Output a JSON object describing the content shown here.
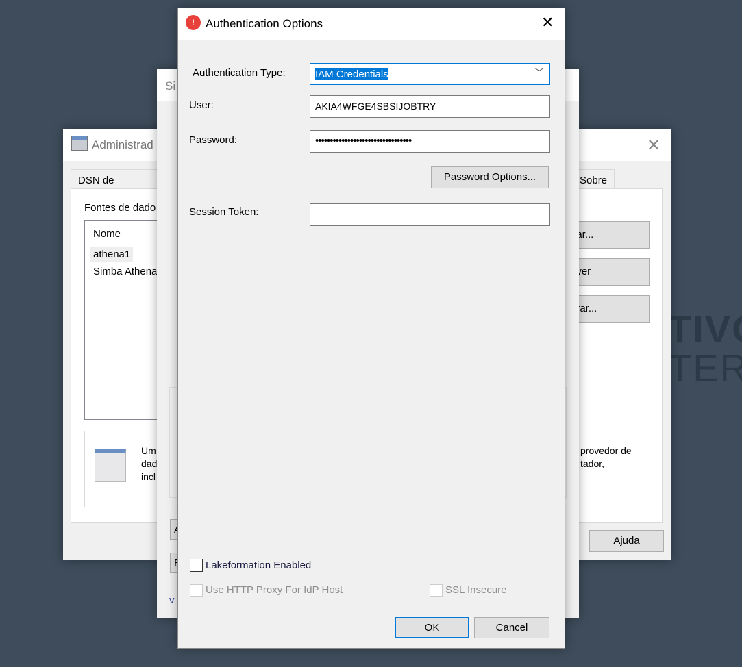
{
  "background": {
    "text_line1": "TIVO",
    "text_line2": "TER",
    "color": "#3e4c5b"
  },
  "admin_window": {
    "title": "Administrad",
    "tabs": [
      "DSN de Usuário",
      "Sobre"
    ],
    "group_label": "Fontes de dado",
    "list_header": "Nome",
    "list_items": [
      "athena1",
      "Simba Athena"
    ],
    "buttons": [
      "nar...",
      "over",
      "urar..."
    ],
    "description_left": [
      "Um",
      "dad",
      "incl"
    ],
    "description_right": [
      "provedor de",
      "tador,"
    ],
    "help_button": "Ajuda"
  },
  "middle_window": {
    "title": "Si",
    "buttons": [
      "A",
      "E"
    ],
    "version_text": "v"
  },
  "auth_dialog": {
    "title": "Authentication Options",
    "icon": "simba-logo-icon",
    "accent_color": "#e8413c",
    "auth_type_label": "Authentication Type:",
    "auth_type_value": "IAM Credentials",
    "user_label": "User:",
    "user_value": "AKIA4WFGE4SBSIJOBTRY",
    "password_label": "Password:",
    "password_value": "•••••••••••••••••••••••••••••••••",
    "password_options_button": "Password Options...",
    "session_token_label": "Session Token:",
    "session_token_value": "",
    "lakeformation_label": "Lakeformation Enabled",
    "lakeformation_checked": false,
    "http_proxy_label": "Use HTTP Proxy For IdP Host",
    "http_proxy_checked": false,
    "ssl_insecure_label": "SSL Insecure",
    "ssl_insecure_checked": false,
    "ok_button": "OK",
    "cancel_button": "Cancel"
  }
}
